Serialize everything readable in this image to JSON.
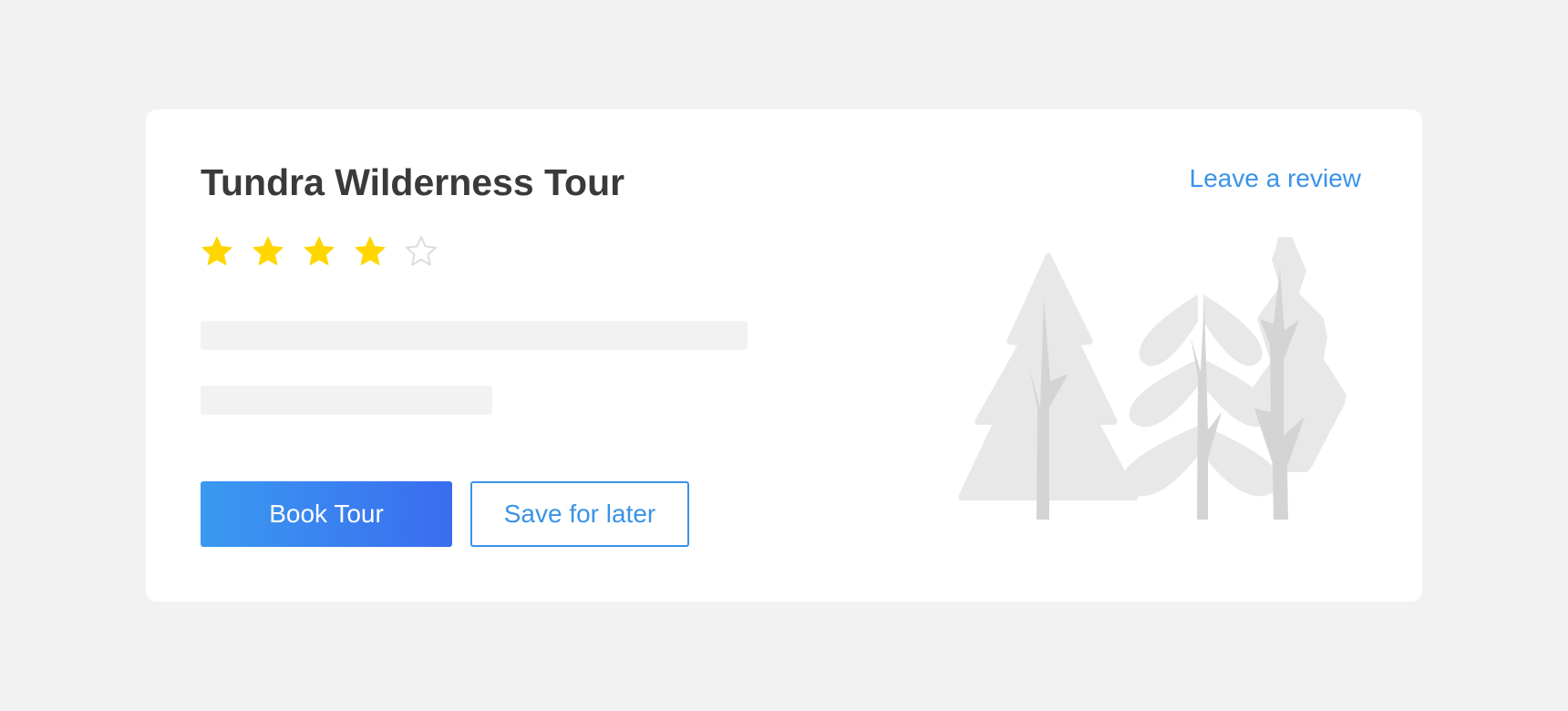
{
  "card": {
    "title": "Tundra Wilderness Tour",
    "review_link": "Leave a review",
    "rating": {
      "value": 4,
      "max": 5,
      "filled_color": "#ffd600",
      "empty_color": "#dddddd"
    },
    "actions": {
      "primary_label": "Book Tour",
      "secondary_label": "Save for later"
    },
    "illustration": {
      "icons": [
        "pine-tree-icon",
        "leafy-tree-icon",
        "poplar-tree-icon"
      ]
    }
  },
  "colors": {
    "page_background": "#f2f2f2",
    "card_background": "#ffffff",
    "title_text": "#3a3a3a",
    "link_accent": "#3a93e8",
    "button_gradient_start": "#3a9af0",
    "button_gradient_end": "#3a6cf0",
    "placeholder": "#f2f2f2",
    "tree_canopy": "#e8e8e8",
    "tree_trunk": "#d4d4d4"
  }
}
